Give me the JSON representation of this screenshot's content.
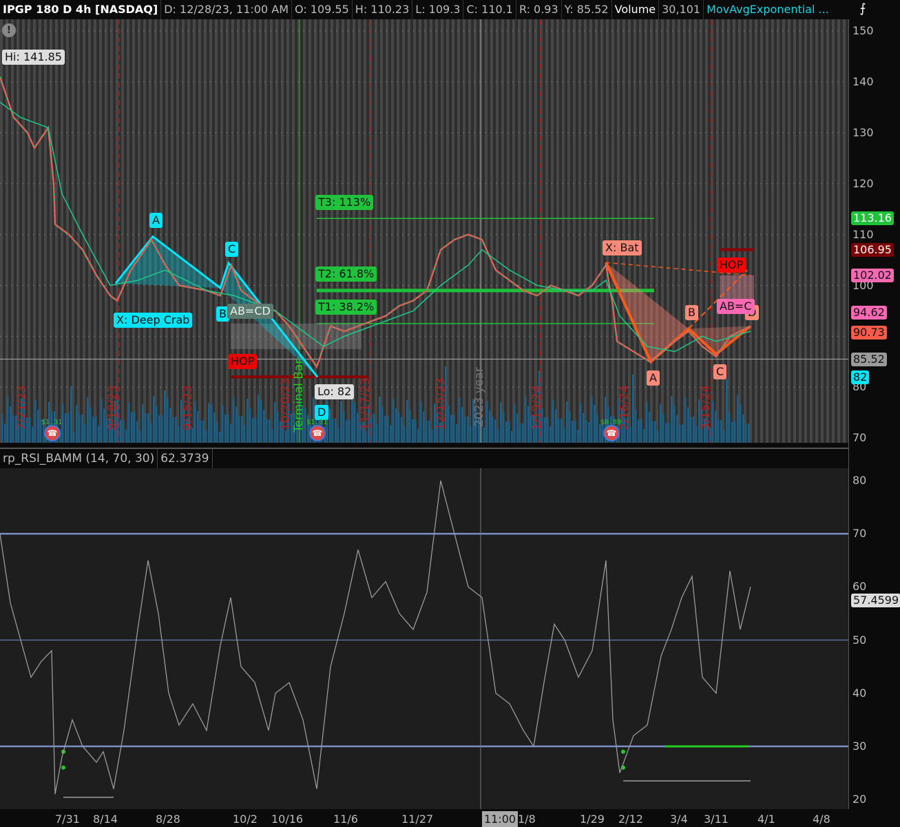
{
  "header": {
    "symbol": "IPGP 180 D 4h [NASDAQ]",
    "date": "D: 12/28/23, 11:00 AM",
    "open": "O: 109.55",
    "high": "H: 110.23",
    "low": "L: 109.3",
    "close": "C: 110.1",
    "range": "R: 0.93",
    "y": "Y: 85.52",
    "volume_label": "Volume",
    "volume": "30,101",
    "study": "MovAvgExponential ..."
  },
  "price_axis": {
    "ticks": [
      "150",
      "140",
      "130",
      "120",
      "110",
      "100",
      "90",
      "80",
      "70"
    ],
    "tags": [
      {
        "v": "113.16",
        "bg": "#1fc23a",
        "fg": "#fff"
      },
      {
        "v": "106.95",
        "bg": "#7a0000",
        "fg": "#fff"
      },
      {
        "v": "102.02",
        "bg": "#ff69b4",
        "fg": "#111"
      },
      {
        "v": "94.62",
        "bg": "#ff69b4",
        "fg": "#111"
      },
      {
        "v": "90.73",
        "bg": "#ff5a4a",
        "fg": "#111"
      },
      {
        "v": "85.52",
        "bg": "#9a9a9a",
        "fg": "#111"
      },
      {
        "v": "82",
        "bg": "#00e5ff",
        "fg": "#111"
      }
    ]
  },
  "annotations": {
    "hi": "Hi: 141.85",
    "lo": "Lo: 82",
    "crab": "X: Deep Crab",
    "crab_a": "A",
    "crab_b": "B",
    "crab_c": "C",
    "crab_d": "D",
    "abcd": "AB=CD",
    "hop1": "HOP",
    "t3": "T3: 113%",
    "t2": "T2: 61.8%",
    "t1": "T1: 38.2%",
    "bat": "X: Bat",
    "bat_a": "A",
    "bat_b": "B",
    "bat_c": "C",
    "bat_d": "D",
    "hop2": "HOP",
    "abcd2": "AB=C",
    "terminal": "Terminal Bar",
    "year": "2023 year",
    "div1": "$1.31",
    "div2": "$1.31",
    "div3": "$0.89"
  },
  "vertical_dates": [
    "7/21/23",
    "8/18/23",
    "9/15/23",
    "10/20/23",
    "11/17/23",
    "12/15/23",
    "1/19/24",
    "2/16/24",
    "3/15/24"
  ],
  "rsi": {
    "title": "rp_RSI_BAMM (14, 70, 30)",
    "value": "62.3739",
    "ticks": [
      "80",
      "70",
      "60",
      "50",
      "40",
      "30",
      "20"
    ],
    "tag": "57.4599"
  },
  "x_axis": {
    "labels": [
      "7/31",
      "8/14",
      "8/28",
      "10/2",
      "10/16",
      "11/6",
      "11/27",
      "11:00",
      "1/8",
      "1/29",
      "2/12",
      "3/4",
      "3/11",
      "4/1",
      "4/8"
    ]
  },
  "chart_data": [
    {
      "type": "line",
      "title": "IPGP 180 D 4h",
      "ylim": [
        70,
        152
      ],
      "series": [
        {
          "name": "Price",
          "points": [
            [
              0,
              141
            ],
            [
              2.5,
              137
            ],
            [
              5,
              133
            ],
            [
              10,
              130
            ],
            [
              12.5,
              127
            ],
            [
              17.5,
              131
            ],
            [
              19.5,
              120
            ],
            [
              20,
              112
            ],
            [
              25,
              110
            ],
            [
              30,
              107
            ],
            [
              35,
              102
            ],
            [
              40,
              98
            ],
            [
              42.5,
              97
            ],
            [
              47.5,
              103
            ],
            [
              55,
              109
            ],
            [
              60,
              104
            ],
            [
              65,
              100
            ],
            [
              75,
              99
            ],
            [
              80,
              98
            ],
            [
              84,
              104
            ],
            [
              87.5,
              99
            ],
            [
              95,
              96
            ],
            [
              100,
              95
            ],
            [
              105,
              92
            ],
            [
              110,
              88
            ],
            [
              115,
              84
            ],
            [
              117.5,
              88
            ],
            [
              120,
              92
            ],
            [
              125,
              91
            ],
            [
              130,
              92
            ],
            [
              135,
              93
            ],
            [
              140,
              94
            ],
            [
              145,
              96
            ],
            [
              150,
              97
            ],
            [
              155,
              99
            ],
            [
              160,
              107
            ],
            [
              165,
              109
            ],
            [
              170,
              110
            ],
            [
              175,
              109
            ],
            [
              180,
              103
            ],
            [
              185,
              101
            ],
            [
              190,
              99
            ],
            [
              195,
              98
            ],
            [
              200,
              100
            ],
            [
              205,
              99
            ],
            [
              210,
              98
            ],
            [
              215,
              100
            ],
            [
              220,
              104
            ],
            [
              222.5,
              96
            ],
            [
              224,
              89
            ],
            [
              230,
              87
            ],
            [
              236,
              85
            ],
            [
              242.5,
              88
            ],
            [
              250,
              91
            ],
            [
              255,
              88
            ],
            [
              260,
              86
            ],
            [
              265,
              90
            ],
            [
              272.5,
              92
            ]
          ]
        },
        {
          "name": "MovAvgExponential",
          "points": [
            [
              0,
              136
            ],
            [
              7.5,
              133
            ],
            [
              17.5,
              131
            ],
            [
              22.5,
              118
            ],
            [
              30,
              110
            ],
            [
              40,
              100
            ],
            [
              50,
              101
            ],
            [
              60,
              103
            ],
            [
              75,
              99
            ],
            [
              85,
              98
            ],
            [
              100,
              95
            ],
            [
              110,
              91
            ],
            [
              117.5,
              88
            ],
            [
              125,
              90
            ],
            [
              135,
              92
            ],
            [
              150,
              95
            ],
            [
              160,
              100
            ],
            [
              170,
              104
            ],
            [
              175,
              107
            ],
            [
              185,
              103
            ],
            [
              195,
              100
            ],
            [
              205,
              99
            ],
            [
              215,
              99
            ],
            [
              220,
              101
            ],
            [
              225,
              94
            ],
            [
              235,
              88
            ],
            [
              245,
              87
            ],
            [
              255,
              90
            ],
            [
              260,
              89
            ],
            [
              272.5,
              91
            ]
          ]
        }
      ],
      "levels": [
        {
          "name": "T3",
          "value": 113.16
        },
        {
          "name": "T2",
          "value": 99
        },
        {
          "name": "T1",
          "value": 92.5
        },
        {
          "name": "Y",
          "value": 85.52
        }
      ]
    },
    {
      "type": "line",
      "title": "rp_RSI_BAMM (14, 70, 30)",
      "ylim": [
        18,
        82
      ],
      "levels": [
        70,
        50,
        30
      ],
      "series": [
        {
          "name": "RSI",
          "points": [
            [
              0,
              70
            ],
            [
              3.75,
              57
            ],
            [
              7.5,
              50
            ],
            [
              11.25,
              43
            ],
            [
              15,
              46
            ],
            [
              18.75,
              48
            ],
            [
              20,
              21
            ],
            [
              22.5,
              28
            ],
            [
              26.25,
              35
            ],
            [
              30,
              30
            ],
            [
              35,
              27
            ],
            [
              37.5,
              29
            ],
            [
              41.25,
              22
            ],
            [
              45,
              33
            ],
            [
              50,
              52
            ],
            [
              53.75,
              65
            ],
            [
              57.5,
              55
            ],
            [
              61.25,
              40
            ],
            [
              65,
              34
            ],
            [
              70,
              38
            ],
            [
              75,
              33
            ],
            [
              80,
              49
            ],
            [
              83.75,
              58
            ],
            [
              87.5,
              45
            ],
            [
              92.5,
              42
            ],
            [
              97.5,
              33
            ],
            [
              100,
              40
            ],
            [
              105,
              42
            ],
            [
              110,
              35
            ],
            [
              115,
              22
            ],
            [
              120,
              45
            ],
            [
              125,
              55
            ],
            [
              130,
              67
            ],
            [
              135,
              58
            ],
            [
              140,
              61
            ],
            [
              145,
              55
            ],
            [
              150,
              52
            ],
            [
              155,
              59
            ],
            [
              160,
              80
            ],
            [
              165,
              70
            ],
            [
              170,
              60
            ],
            [
              175,
              58
            ],
            [
              180,
              40
            ],
            [
              185,
              38
            ],
            [
              190,
              33
            ],
            [
              193.75,
              30
            ],
            [
              197.5,
              42
            ],
            [
              201.25,
              53
            ],
            [
              205,
              50
            ],
            [
              210,
              43
            ],
            [
              215,
              48
            ],
            [
              220,
              65
            ],
            [
              222.5,
              35
            ],
            [
              225,
              25
            ],
            [
              230,
              32
            ],
            [
              235,
              34
            ],
            [
              240,
              47
            ],
            [
              243.75,
              52
            ],
            [
              247.5,
              58
            ],
            [
              251.25,
              62
            ],
            [
              255,
              43
            ],
            [
              260,
              40
            ],
            [
              265,
              63
            ],
            [
              268.75,
              52
            ],
            [
              272.5,
              60
            ]
          ]
        }
      ]
    }
  ]
}
